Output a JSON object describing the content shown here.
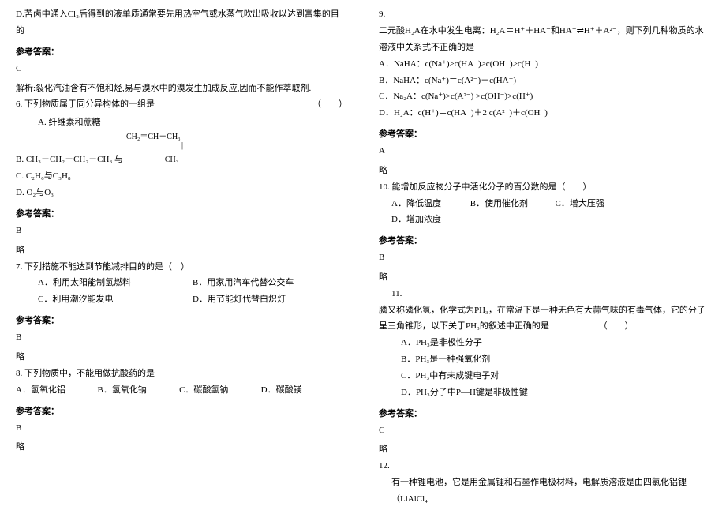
{
  "left": {
    "option_d": "D.苦卤中通入Cl₂后得到的液单质通常要先用热空气或水蒸气吹出吸收以达到富集的目的",
    "answer_label": "参考答案：",
    "answer5": "C",
    "explain5": "解析:裂化汽油含有不饱和烃,易与溴水中的溴发生加成反应,因而不能作萃取剂.",
    "q6_title": "6. 下列物质属于同分异构体的一组是",
    "q6_paren": "（　　）",
    "q6_a": "A. 纤维素和蔗糖",
    "q6_formula1": "CH₂＝CH－CH₃",
    "q6_formula2_mid": "|",
    "q6_formula3": "CH₃",
    "q6_b": "B. CH₃－CH₂－CH₂－CH₃ 与",
    "q6_c": "C. C₂H₆与C₃H₈",
    "q6_d": "D. O₂与O₃",
    "answer6": "B",
    "lue": "略",
    "q7_title": "7. 下列措施不能达到节能减排目的的是（　）",
    "q7_a": "A．利用太阳能制氢燃料",
    "q7_b": "B．用家用汽车代替公交车",
    "q7_c": "C．利用潮汐能发电",
    "q7_d": "D．用节能灯代替白炽灯",
    "answer7": "B",
    "q8_title": "8. 下列物质中，不能用做抗酸药的是",
    "q8_a": "A．氢氧化铝",
    "q8_b": "B．氢氧化钠",
    "q8_c": "C．碳酸氢钠",
    "q8_d": "D．碳酸镁",
    "answer8": "B"
  },
  "right": {
    "q9_num": "9.",
    "q9_body": "二元酸H₂A在水中发生电离：H₂A＝H⁺＋HA⁻和HA⁻⇌H⁺＋A²⁻，则下列几种物质的水溶液中关系式不正确的是",
    "q9_a": "A．NaHA：c(Na⁺)>c(HA⁻)>c(OH⁻)>c(H⁺)",
    "q9_b": "B．NaHA：c(Na⁺)＝c(A²⁻)＋c(HA⁻)",
    "q9_c": "C．Na₂A：c(Na⁺)>c(A²⁻) >c(OH⁻)>c(H⁺)",
    "q9_d": "D．H₂A：c(H⁺)＝c(HA⁻)＋2 c(A²⁻)＋c(OH⁻)",
    "answer_label": "参考答案：",
    "answer9": "A",
    "lue": "略",
    "q10_title": "10. 能增加反应物分子中活化分子的百分数的是（　　）",
    "q10_a": "A．降低温度",
    "q10_b": "B．使用催化剂",
    "q10_c": "C．增大压强",
    "q10_d": "D．增加浓度",
    "answer10": "B",
    "q11_num": "11.",
    "q11_body": "膦又称磷化氢，化学式为PH₃，在常温下是一种无色有大蒜气味的有毒气体，它的分子呈三角锥形，以下关于PH₃的叙述中正确的是",
    "q11_paren": "（　　）",
    "q11_a": "A．PH₃是非极性分子",
    "q11_b": "B．PH₃是一种强氧化剂",
    "q11_c": "C．PH₃中有未成键电子对",
    "q11_d": "D．PH₃分子中P—H键是非极性键",
    "answer11": "C",
    "q12_num": "12.",
    "q12_body": "有一种锂电池，它是用金属锂和石墨作电极材料，电解质溶液是由四氯化铝锂（LiAlCl₄"
  }
}
